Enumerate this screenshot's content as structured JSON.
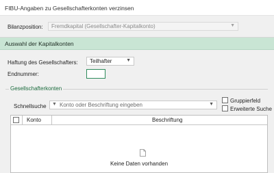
{
  "window": {
    "title": "FIBU-Angaben zu Gesellschafterkonten verzinsen"
  },
  "bilanzposition": {
    "label": "Bilanzposition:",
    "value": "Fremdkapital (Gesellschafter-Kapitalkonto)"
  },
  "section": {
    "title": "Auswahl der Kapitalkonten"
  },
  "haftung": {
    "label": "Haftung des Gesellschafters:",
    "value": "Teilhafter"
  },
  "endnummer": {
    "label": "Endnummer:",
    "value": ""
  },
  "gesellschafterkonten": {
    "group_title": "Gesellschafterkonten",
    "schnellsuche_label": "Schnellsuche",
    "search_placeholder": "Konto oder Beschriftung eingeben",
    "gruppierfeld_label": "Gruppierfeld",
    "erweiterte_suche_label": "Erweiterte Suche"
  },
  "table": {
    "columns": [
      "Konto",
      "Beschriftung"
    ],
    "empty_text": "Keine Daten vorhanden"
  },
  "colors": {
    "section_header_bg": "#c9e5d4",
    "accent_green": "#2c8a5a",
    "group_title_color": "#1b6b3d"
  }
}
